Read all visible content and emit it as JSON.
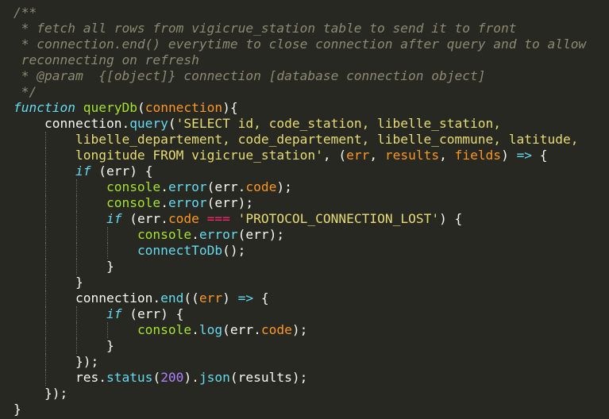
{
  "editor": {
    "language": "javascript",
    "theme_colors": {
      "background": "#272822",
      "comment": "#8c8a73",
      "keyword": "#66d9ef",
      "function_name": "#a6e22e",
      "parameter": "#fd971f",
      "string": "#e6db74",
      "number": "#ae81ff",
      "operator": "#f92672",
      "plain": "#f8f8f2"
    },
    "lines": [
      {
        "indent": 0,
        "tokens": [
          {
            "t": "/**",
            "c": "cmt"
          }
        ]
      },
      {
        "indent": 0,
        "tokens": [
          {
            "t": " * fetch all rows from vigicrue_station table to send it to front",
            "c": "cmt"
          }
        ]
      },
      {
        "indent": 0,
        "tokens": [
          {
            "t": " * connection.end() everytime to close connection after query and to allow",
            "c": "cmt"
          }
        ]
      },
      {
        "indent": 0,
        "tokens": [
          {
            "t": " reconnecting on refresh",
            "c": "cmt"
          }
        ]
      },
      {
        "indent": 0,
        "tokens": [
          {
            "t": " * @param  {[object]} connection [database connection object]",
            "c": "cmt"
          }
        ]
      },
      {
        "indent": 0,
        "tokens": [
          {
            "t": " */",
            "c": "cmt"
          }
        ]
      },
      {
        "indent": 0,
        "tokens": [
          {
            "t": "function",
            "c": "kw"
          },
          {
            "t": " ",
            "c": "pln"
          },
          {
            "t": "queryDb",
            "c": "fn"
          },
          {
            "t": "(",
            "c": "pln"
          },
          {
            "t": "connection",
            "c": "prm"
          },
          {
            "t": "){",
            "c": "pln"
          }
        ]
      },
      {
        "indent": 1,
        "tokens": [
          {
            "t": "connection.",
            "c": "pln"
          },
          {
            "t": "query",
            "c": "call"
          },
          {
            "t": "(",
            "c": "pln"
          },
          {
            "t": "'SELECT id, code_station, libelle_station,",
            "c": "str"
          }
        ]
      },
      {
        "indent": 2,
        "tokens": [
          {
            "t": "libelle_departement, code_departement, libelle_commune, latitude,",
            "c": "str"
          }
        ]
      },
      {
        "indent": 2,
        "tokens": [
          {
            "t": "longitude FROM vigicrue_station'",
            "c": "str"
          },
          {
            "t": ", (",
            "c": "pln"
          },
          {
            "t": "err",
            "c": "prm"
          },
          {
            "t": ", ",
            "c": "pln"
          },
          {
            "t": "results",
            "c": "prm"
          },
          {
            "t": ", ",
            "c": "pln"
          },
          {
            "t": "fields",
            "c": "prm"
          },
          {
            "t": ") ",
            "c": "pln"
          },
          {
            "t": "=>",
            "c": "kw"
          },
          {
            "t": " {",
            "c": "pln"
          }
        ]
      },
      {
        "indent": 2,
        "tokens": [
          {
            "t": "if",
            "c": "kw"
          },
          {
            "t": " (err) {",
            "c": "pln"
          }
        ]
      },
      {
        "indent": 3,
        "tokens": [
          {
            "t": "console",
            "c": "fn"
          },
          {
            "t": ".",
            "c": "pln"
          },
          {
            "t": "error",
            "c": "call"
          },
          {
            "t": "(err.",
            "c": "pln"
          },
          {
            "t": "code",
            "c": "prm"
          },
          {
            "t": ");",
            "c": "pln"
          }
        ]
      },
      {
        "indent": 3,
        "tokens": [
          {
            "t": "console",
            "c": "fn"
          },
          {
            "t": ".",
            "c": "pln"
          },
          {
            "t": "error",
            "c": "call"
          },
          {
            "t": "(err);",
            "c": "pln"
          }
        ]
      },
      {
        "indent": 3,
        "tokens": [
          {
            "t": "if",
            "c": "kw"
          },
          {
            "t": " (err.",
            "c": "pln"
          },
          {
            "t": "code",
            "c": "prm"
          },
          {
            "t": " ",
            "c": "pln"
          },
          {
            "t": "===",
            "c": "op"
          },
          {
            "t": " ",
            "c": "pln"
          },
          {
            "t": "'PROTOCOL_CONNECTION_LOST'",
            "c": "str"
          },
          {
            "t": ") {",
            "c": "pln"
          }
        ]
      },
      {
        "indent": 4,
        "tokens": [
          {
            "t": "console",
            "c": "fn"
          },
          {
            "t": ".",
            "c": "pln"
          },
          {
            "t": "error",
            "c": "call"
          },
          {
            "t": "(err);",
            "c": "pln"
          }
        ]
      },
      {
        "indent": 4,
        "tokens": [
          {
            "t": "connectToDb",
            "c": "call"
          },
          {
            "t": "();",
            "c": "pln"
          }
        ]
      },
      {
        "indent": 3,
        "tokens": [
          {
            "t": "}",
            "c": "pln"
          }
        ]
      },
      {
        "indent": 2,
        "tokens": [
          {
            "t": "}",
            "c": "pln"
          }
        ]
      },
      {
        "indent": 2,
        "tokens": [
          {
            "t": "connection.",
            "c": "pln"
          },
          {
            "t": "end",
            "c": "call"
          },
          {
            "t": "((",
            "c": "pln"
          },
          {
            "t": "err",
            "c": "prm"
          },
          {
            "t": ") ",
            "c": "pln"
          },
          {
            "t": "=>",
            "c": "kw"
          },
          {
            "t": " {",
            "c": "pln"
          }
        ]
      },
      {
        "indent": 3,
        "tokens": [
          {
            "t": "if",
            "c": "kw"
          },
          {
            "t": " (err) {",
            "c": "pln"
          }
        ]
      },
      {
        "indent": 4,
        "tokens": [
          {
            "t": "console",
            "c": "fn"
          },
          {
            "t": ".",
            "c": "pln"
          },
          {
            "t": "log",
            "c": "call"
          },
          {
            "t": "(err.",
            "c": "pln"
          },
          {
            "t": "code",
            "c": "prm"
          },
          {
            "t": ");",
            "c": "pln"
          }
        ]
      },
      {
        "indent": 3,
        "tokens": [
          {
            "t": "}",
            "c": "pln"
          }
        ]
      },
      {
        "indent": 2,
        "tokens": [
          {
            "t": "});",
            "c": "pln"
          }
        ]
      },
      {
        "indent": 2,
        "tokens": [
          {
            "t": "res.",
            "c": "pln"
          },
          {
            "t": "status",
            "c": "call"
          },
          {
            "t": "(",
            "c": "pln"
          },
          {
            "t": "200",
            "c": "num"
          },
          {
            "t": ").",
            "c": "pln"
          },
          {
            "t": "json",
            "c": "call"
          },
          {
            "t": "(results);",
            "c": "pln"
          }
        ]
      },
      {
        "indent": 1,
        "tokens": [
          {
            "t": "});",
            "c": "pln"
          }
        ]
      },
      {
        "indent": 0,
        "tokens": [
          {
            "t": "}",
            "c": "pln"
          }
        ]
      }
    ]
  }
}
